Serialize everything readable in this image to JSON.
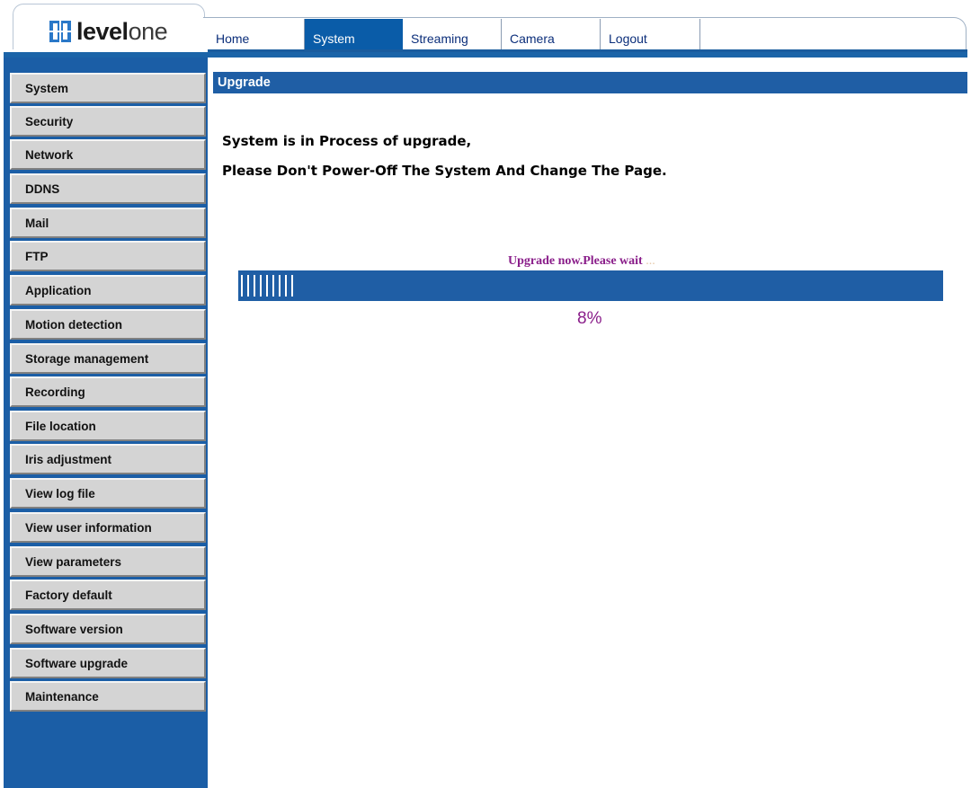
{
  "brand": {
    "logo_text_bold": "level",
    "logo_text_light": "one",
    "logo_icon": "levelone-logo-icon",
    "accent_color": "#1b5ea6"
  },
  "nav": {
    "tabs": [
      {
        "label": "Home",
        "active": false
      },
      {
        "label": "System",
        "active": true
      },
      {
        "label": "Streaming",
        "active": false
      },
      {
        "label": "Camera",
        "active": false
      },
      {
        "label": "Logout",
        "active": false
      }
    ]
  },
  "sidebar": {
    "items": [
      {
        "label": "System"
      },
      {
        "label": "Security"
      },
      {
        "label": "Network"
      },
      {
        "label": "DDNS"
      },
      {
        "label": "Mail"
      },
      {
        "label": "FTP"
      },
      {
        "label": "Application"
      },
      {
        "label": "Motion detection"
      },
      {
        "label": "Storage management"
      },
      {
        "label": "Recording"
      },
      {
        "label": "File location"
      },
      {
        "label": "Iris adjustment"
      },
      {
        "label": "View log file"
      },
      {
        "label": "View user information"
      },
      {
        "label": "View parameters"
      },
      {
        "label": "Factory default"
      },
      {
        "label": "Software version"
      },
      {
        "label": "Software upgrade"
      },
      {
        "label": "Maintenance"
      }
    ]
  },
  "main": {
    "section_title": "Upgrade",
    "message_line1": "System is in Process of upgrade,",
    "message_line2": "Please Don't Power-Off The System And Change The Page.",
    "wait_text": "Upgrade now.Please wait",
    "wait_dots": "...",
    "progress_percent": 8,
    "progress_label": "8%"
  }
}
